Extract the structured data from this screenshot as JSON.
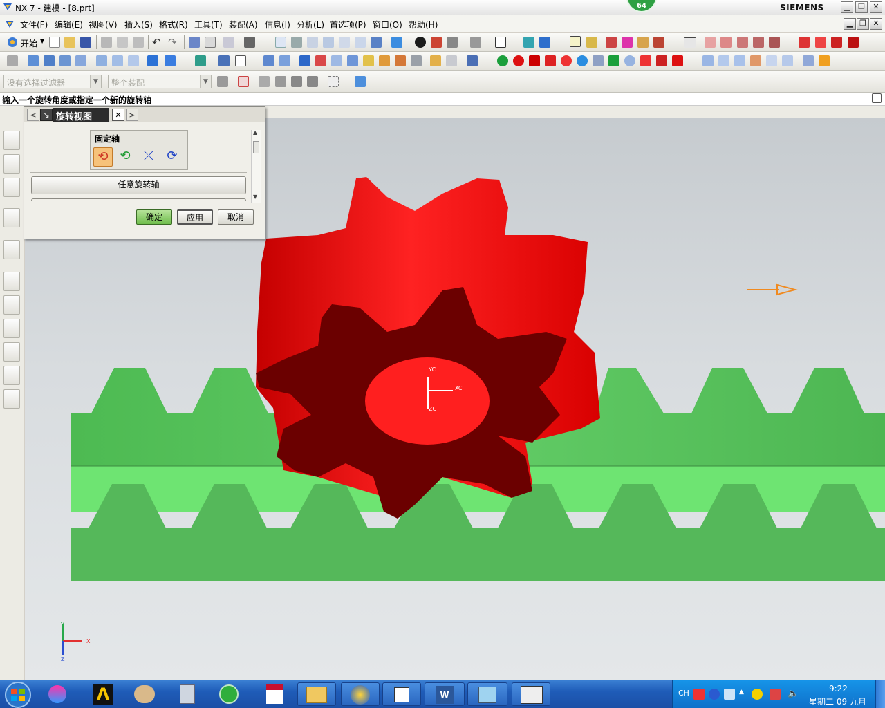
{
  "window": {
    "title": "NX 7 - 建模 - [8.prt]",
    "brand": "SIEMENS",
    "badge": "64",
    "controls": {
      "minimize": "▁",
      "restore": "❐",
      "close": "✕"
    }
  },
  "menu": {
    "items": [
      "文件(F)",
      "编辑(E)",
      "视图(V)",
      "插入(S)",
      "格式(R)",
      "工具(T)",
      "装配(A)",
      "信息(I)",
      "分析(L)",
      "首选项(P)",
      "窗口(O)",
      "帮助(H)"
    ]
  },
  "toolbar": {
    "start_label": "开始",
    "filter_placeholder": "没有选择过滤器",
    "assembly_placeholder": "整个装配"
  },
  "cue": "输入一个旋转角度或指定一个新的旋转轴",
  "dialog": {
    "title": "旋转视图",
    "group_label": "固定轴",
    "arbitrary_axis": "任意旋转轴",
    "ok": "确定",
    "apply": "应用",
    "cancel": "取消",
    "nav_back": "<",
    "nav_fwd": ">",
    "close": "✕"
  },
  "viewport": {
    "wcs": {
      "x": "XC",
      "y": "YC",
      "z": "ZC"
    },
    "triad": {
      "x": "X",
      "y": "Y",
      "z": "Z"
    },
    "colors": {
      "gear_side": "#ff1a1a",
      "gear_face": "#6a0000",
      "rack": "#58c95c"
    }
  },
  "taskbar": {
    "lang": "CH",
    "time": "9:22",
    "date": "星期二 09 九月"
  }
}
